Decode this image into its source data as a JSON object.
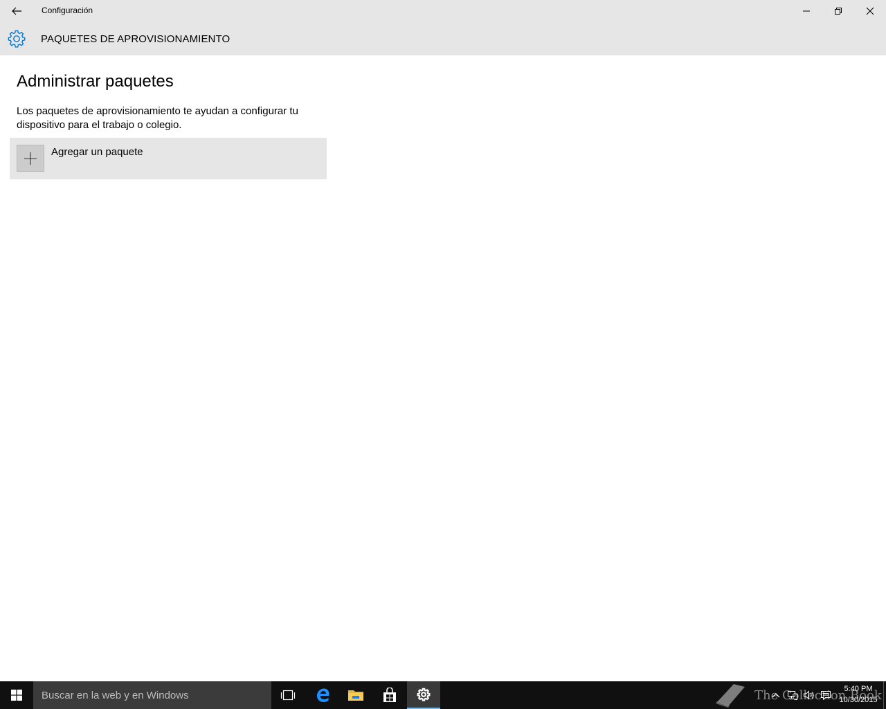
{
  "window": {
    "title": "Configuración",
    "controls": [
      "minimize-icon",
      "restore-icon",
      "close-icon"
    ]
  },
  "header": {
    "icon": "gear-icon",
    "title": "PAQUETES DE APROVISIONAMIENTO"
  },
  "main": {
    "heading": "Administrar paquetes",
    "description": "Los paquetes de aprovisionamiento te ayudan a configurar tu dispositivo para el trabajo o colegio.",
    "add_package": {
      "icon": "plus-icon",
      "label": "Agregar un paquete"
    }
  },
  "taskbar": {
    "search_placeholder": "Buscar en la web y en Windows",
    "pinned": [
      "task-view-icon",
      "edge-icon",
      "file-explorer-icon",
      "store-icon",
      "settings-icon"
    ],
    "active_app": "settings-icon",
    "watermark": "The Collection Book",
    "clock": {
      "time": "5:40 PM",
      "date": "10/30/2015"
    }
  },
  "colors": {
    "accent": "#0078d7",
    "chrome": "#e6e6e6",
    "taskbar": "#101010",
    "active_indicator": "#76b9ed"
  }
}
